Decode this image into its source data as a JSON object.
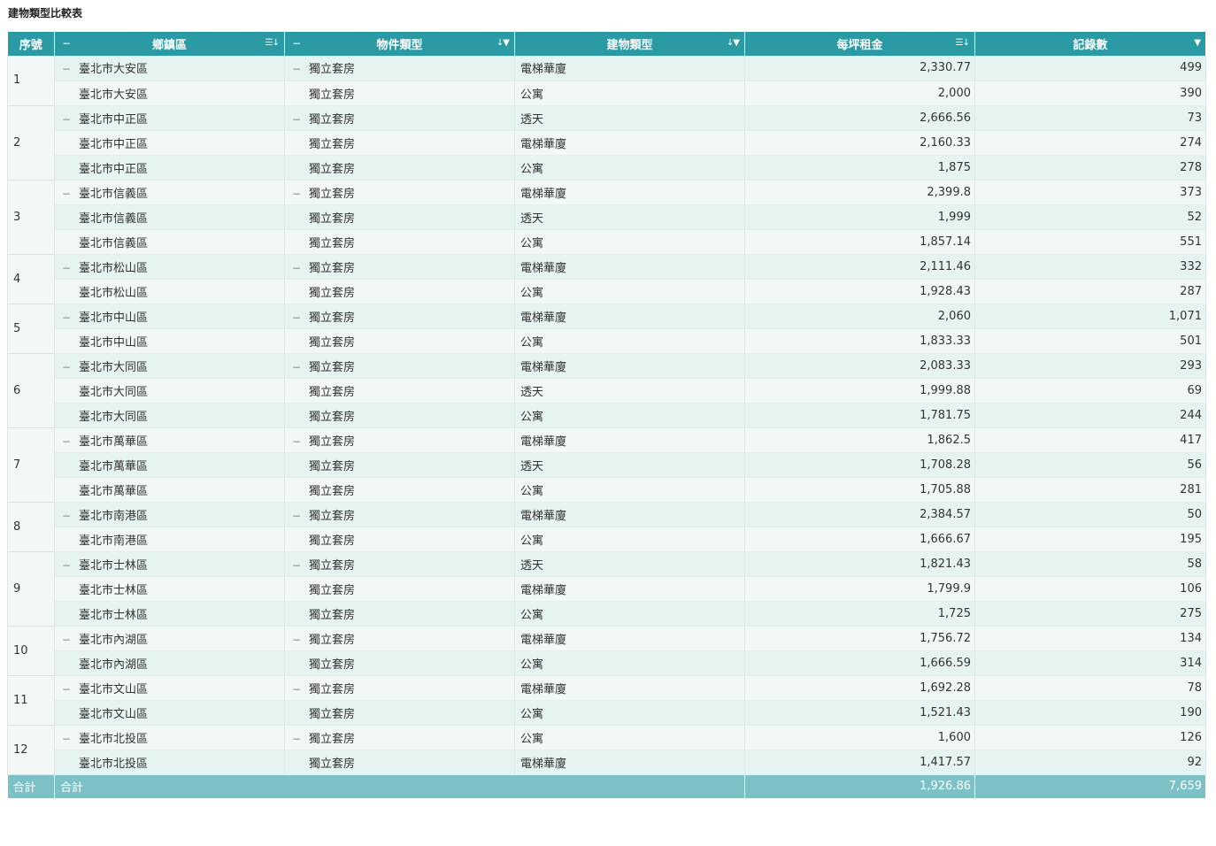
{
  "title": "建物類型比較表",
  "columns": {
    "index": "序號",
    "district": "鄉鎮區",
    "property_type": "物件類型",
    "building_type": "建物類型",
    "rent_per_ping": "每坪租金",
    "record_count": "記錄數"
  },
  "icons": {
    "district_sort": "sort-desc-list-icon",
    "property_sort": "sort-filter-icon",
    "building_sort": "sort-filter-icon",
    "rent_sort": "sort-desc-list-icon",
    "count_filter": "filter-icon",
    "collapse": "minus-icon"
  },
  "groups": [
    {
      "index": "1",
      "rows": [
        {
          "district": "臺北市大安區",
          "property": "獨立套房",
          "building": "電梯華廈",
          "rent": "2,330.77",
          "count": "499"
        },
        {
          "district": "臺北市大安區",
          "property": "獨立套房",
          "building": "公寓",
          "rent": "2,000",
          "count": "390"
        }
      ]
    },
    {
      "index": "2",
      "rows": [
        {
          "district": "臺北市中正區",
          "property": "獨立套房",
          "building": "透天",
          "rent": "2,666.56",
          "count": "73"
        },
        {
          "district": "臺北市中正區",
          "property": "獨立套房",
          "building": "電梯華廈",
          "rent": "2,160.33",
          "count": "274"
        },
        {
          "district": "臺北市中正區",
          "property": "獨立套房",
          "building": "公寓",
          "rent": "1,875",
          "count": "278"
        }
      ]
    },
    {
      "index": "3",
      "rows": [
        {
          "district": "臺北市信義區",
          "property": "獨立套房",
          "building": "電梯華廈",
          "rent": "2,399.8",
          "count": "373"
        },
        {
          "district": "臺北市信義區",
          "property": "獨立套房",
          "building": "透天",
          "rent": "1,999",
          "count": "52"
        },
        {
          "district": "臺北市信義區",
          "property": "獨立套房",
          "building": "公寓",
          "rent": "1,857.14",
          "count": "551"
        }
      ]
    },
    {
      "index": "4",
      "rows": [
        {
          "district": "臺北市松山區",
          "property": "獨立套房",
          "building": "電梯華廈",
          "rent": "2,111.46",
          "count": "332"
        },
        {
          "district": "臺北市松山區",
          "property": "獨立套房",
          "building": "公寓",
          "rent": "1,928.43",
          "count": "287"
        }
      ]
    },
    {
      "index": "5",
      "rows": [
        {
          "district": "臺北市中山區",
          "property": "獨立套房",
          "building": "電梯華廈",
          "rent": "2,060",
          "count": "1,071"
        },
        {
          "district": "臺北市中山區",
          "property": "獨立套房",
          "building": "公寓",
          "rent": "1,833.33",
          "count": "501"
        }
      ]
    },
    {
      "index": "6",
      "rows": [
        {
          "district": "臺北市大同區",
          "property": "獨立套房",
          "building": "電梯華廈",
          "rent": "2,083.33",
          "count": "293"
        },
        {
          "district": "臺北市大同區",
          "property": "獨立套房",
          "building": "透天",
          "rent": "1,999.88",
          "count": "69"
        },
        {
          "district": "臺北市大同區",
          "property": "獨立套房",
          "building": "公寓",
          "rent": "1,781.75",
          "count": "244"
        }
      ]
    },
    {
      "index": "7",
      "rows": [
        {
          "district": "臺北市萬華區",
          "property": "獨立套房",
          "building": "電梯華廈",
          "rent": "1,862.5",
          "count": "417"
        },
        {
          "district": "臺北市萬華區",
          "property": "獨立套房",
          "building": "透天",
          "rent": "1,708.28",
          "count": "56"
        },
        {
          "district": "臺北市萬華區",
          "property": "獨立套房",
          "building": "公寓",
          "rent": "1,705.88",
          "count": "281"
        }
      ]
    },
    {
      "index": "8",
      "rows": [
        {
          "district": "臺北市南港區",
          "property": "獨立套房",
          "building": "電梯華廈",
          "rent": "2,384.57",
          "count": "50"
        },
        {
          "district": "臺北市南港區",
          "property": "獨立套房",
          "building": "公寓",
          "rent": "1,666.67",
          "count": "195"
        }
      ]
    },
    {
      "index": "9",
      "rows": [
        {
          "district": "臺北市士林區",
          "property": "獨立套房",
          "building": "透天",
          "rent": "1,821.43",
          "count": "58"
        },
        {
          "district": "臺北市士林區",
          "property": "獨立套房",
          "building": "電梯華廈",
          "rent": "1,799.9",
          "count": "106"
        },
        {
          "district": "臺北市士林區",
          "property": "獨立套房",
          "building": "公寓",
          "rent": "1,725",
          "count": "275"
        }
      ]
    },
    {
      "index": "10",
      "rows": [
        {
          "district": "臺北市內湖區",
          "property": "獨立套房",
          "building": "電梯華廈",
          "rent": "1,756.72",
          "count": "134"
        },
        {
          "district": "臺北市內湖區",
          "property": "獨立套房",
          "building": "公寓",
          "rent": "1,666.59",
          "count": "314"
        }
      ]
    },
    {
      "index": "11",
      "rows": [
        {
          "district": "臺北市文山區",
          "property": "獨立套房",
          "building": "電梯華廈",
          "rent": "1,692.28",
          "count": "78"
        },
        {
          "district": "臺北市文山區",
          "property": "獨立套房",
          "building": "公寓",
          "rent": "1,521.43",
          "count": "190"
        }
      ]
    },
    {
      "index": "12",
      "rows": [
        {
          "district": "臺北市北投區",
          "property": "獨立套房",
          "building": "公寓",
          "rent": "1,600",
          "count": "126"
        },
        {
          "district": "臺北市北投區",
          "property": "獨立套房",
          "building": "電梯華廈",
          "rent": "1,417.57",
          "count": "92"
        }
      ]
    }
  ],
  "totals": {
    "index_label": "合計",
    "label": "合計",
    "rent": "1,926.86",
    "count": "7,659"
  },
  "colors": {
    "header_bg": "#2a9aa5",
    "footer_bg": "#7cc1c6",
    "row_alt_1": "#e6f3f3",
    "row_alt_2": "#f2f8f8"
  }
}
